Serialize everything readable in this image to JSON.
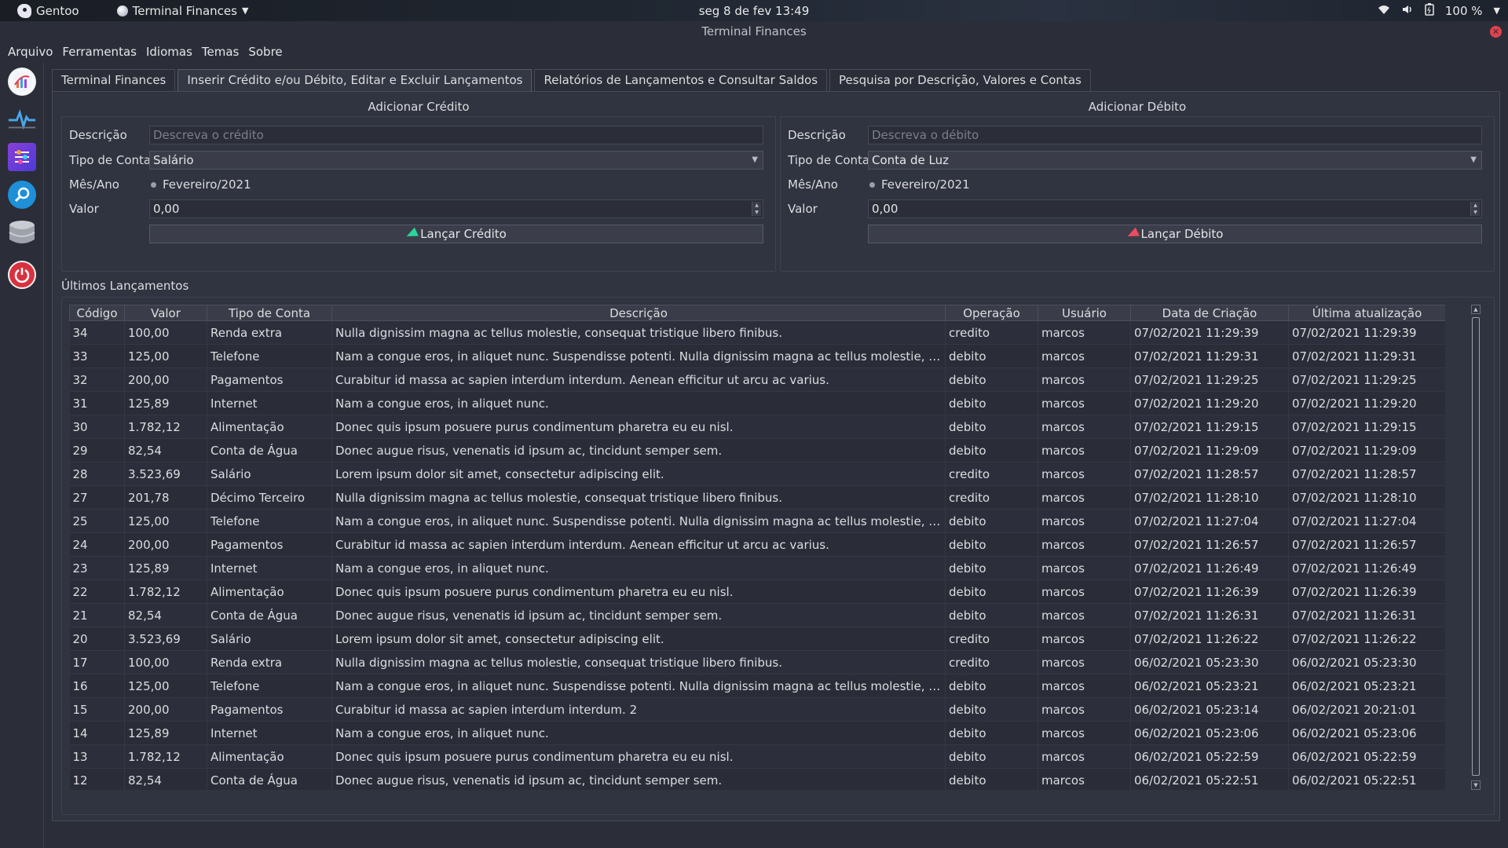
{
  "topbar": {
    "os_name": "Gentoo",
    "app_menu": "Terminal Finances",
    "clock": "seg 8 de fev  13:49",
    "battery": "100 %"
  },
  "window": {
    "title": "Terminal Finances"
  },
  "menu": [
    "Arquivo",
    "Ferramentas",
    "Idiomas",
    "Temas",
    "Sobre"
  ],
  "sidebar_icons": [
    "chart-icon",
    "activity-icon",
    "settings-sliders-icon",
    "search-icon",
    "database-icon",
    "power-icon"
  ],
  "tabs": [
    "Terminal Finances",
    "Inserir Crédito e/ou Débito, Editar e Excluir Lançamentos",
    "Relatórios de Lançamentos e Consultar Saldos",
    "Pesquisa por Descrição, Valores e Contas"
  ],
  "active_tab": 1,
  "credit": {
    "title": "Adicionar Crédito",
    "desc_label": "Descrição",
    "desc_placeholder": "Descreva o crédito",
    "type_label": "Tipo de Conta",
    "type_value": "Salário",
    "month_label": "Mês/Ano",
    "month_value": "Fevereiro/2021",
    "value_label": "Valor",
    "value": "0,00",
    "button": "Lançar Crédito"
  },
  "debit": {
    "title": "Adicionar Débito",
    "desc_label": "Descrição",
    "desc_placeholder": "Descreva o débito",
    "type_label": "Tipo de Conta",
    "type_value": "Conta de Luz",
    "month_label": "Mês/Ano",
    "month_value": "Fevereiro/2021",
    "value_label": "Valor",
    "value": "0,00",
    "button": "Lançar Débito"
  },
  "recent": {
    "title": "Últimos Lançamentos",
    "columns": [
      "Código",
      "Valor",
      "Tipo de Conta",
      "Descrição",
      "Operação",
      "Usuário",
      "Data de Criação",
      "Última atualização"
    ],
    "rows": [
      [
        "34",
        "100,00",
        "Renda extra",
        "Nulla dignissim magna ac tellus molestie, consequat tristique libero finibus.",
        "credito",
        "marcos",
        "07/02/2021 11:29:39",
        "07/02/2021 11:29:39"
      ],
      [
        "33",
        "125,00",
        "Telefone",
        "Nam a congue eros, in aliquet nunc. Suspendisse potenti. Nulla dignissim magna ac tellus molestie, consequat tristique libero finibus.",
        "debito",
        "marcos",
        "07/02/2021 11:29:31",
        "07/02/2021 11:29:31"
      ],
      [
        "32",
        "200,00",
        "Pagamentos",
        "Curabitur id massa ac sapien interdum interdum. Aenean efficitur ut arcu ac varius.",
        "debito",
        "marcos",
        "07/02/2021 11:29:25",
        "07/02/2021 11:29:25"
      ],
      [
        "31",
        "125,89",
        "Internet",
        "Nam a congue eros, in aliquet nunc.",
        "debito",
        "marcos",
        "07/02/2021 11:29:20",
        "07/02/2021 11:29:20"
      ],
      [
        "30",
        "1.782,12",
        "Alimentação",
        "Donec quis ipsum posuere purus condimentum pharetra eu eu nisl.",
        "debito",
        "marcos",
        "07/02/2021 11:29:15",
        "07/02/2021 11:29:15"
      ],
      [
        "29",
        "82,54",
        "Conta de Água",
        "Donec augue risus, venenatis id ipsum ac, tincidunt semper sem.",
        "debito",
        "marcos",
        "07/02/2021 11:29:09",
        "07/02/2021 11:29:09"
      ],
      [
        "28",
        "3.523,69",
        "Salário",
        "Lorem ipsum dolor sit amet, consectetur adipiscing elit.",
        "credito",
        "marcos",
        "07/02/2021 11:28:57",
        "07/02/2021 11:28:57"
      ],
      [
        "27",
        "201,78",
        "Décimo Terceiro",
        "Nulla dignissim magna ac tellus molestie, consequat tristique libero finibus.",
        "credito",
        "marcos",
        "07/02/2021 11:28:10",
        "07/02/2021 11:28:10"
      ],
      [
        "25",
        "125,00",
        "Telefone",
        "Nam a congue eros, in aliquet nunc. Suspendisse potenti. Nulla dignissim magna ac tellus molestie, consequat tristique libero finibus.",
        "debito",
        "marcos",
        "07/02/2021 11:27:04",
        "07/02/2021 11:27:04"
      ],
      [
        "24",
        "200,00",
        "Pagamentos",
        "Curabitur id massa ac sapien interdum interdum. Aenean efficitur ut arcu ac varius.",
        "debito",
        "marcos",
        "07/02/2021 11:26:57",
        "07/02/2021 11:26:57"
      ],
      [
        "23",
        "125,89",
        "Internet",
        "Nam a congue eros, in aliquet nunc.",
        "debito",
        "marcos",
        "07/02/2021 11:26:49",
        "07/02/2021 11:26:49"
      ],
      [
        "22",
        "1.782,12",
        "Alimentação",
        "Donec quis ipsum posuere purus condimentum pharetra eu eu nisl.",
        "debito",
        "marcos",
        "07/02/2021 11:26:39",
        "07/02/2021 11:26:39"
      ],
      [
        "21",
        "82,54",
        "Conta de Água",
        "Donec augue risus, venenatis id ipsum ac, tincidunt semper sem.",
        "debito",
        "marcos",
        "07/02/2021 11:26:31",
        "07/02/2021 11:26:31"
      ],
      [
        "20",
        "3.523,69",
        "Salário",
        "Lorem ipsum dolor sit amet, consectetur adipiscing elit.",
        "credito",
        "marcos",
        "07/02/2021 11:26:22",
        "07/02/2021 11:26:22"
      ],
      [
        "17",
        "100,00",
        "Renda extra",
        "Nulla dignissim magna ac tellus molestie, consequat tristique libero finibus.",
        "credito",
        "marcos",
        "06/02/2021 05:23:30",
        "06/02/2021 05:23:30"
      ],
      [
        "16",
        "125,00",
        "Telefone",
        "Nam a congue eros, in aliquet nunc. Suspendisse potenti. Nulla dignissim magna ac tellus molestie, consequat tristique libero finibus.",
        "debito",
        "marcos",
        "06/02/2021 05:23:21",
        "06/02/2021 05:23:21"
      ],
      [
        "15",
        "200,00",
        "Pagamentos",
        "Curabitur id massa ac sapien interdum interdum.  2",
        "debito",
        "marcos",
        "06/02/2021 05:23:14",
        "06/02/2021 20:21:01"
      ],
      [
        "14",
        "125,89",
        "Internet",
        "Nam a congue eros, in aliquet nunc.",
        "debito",
        "marcos",
        "06/02/2021 05:23:06",
        "06/02/2021 05:23:06"
      ],
      [
        "13",
        "1.782,12",
        "Alimentação",
        "Donec quis ipsum posuere purus condimentum pharetra eu eu nisl.",
        "debito",
        "marcos",
        "06/02/2021 05:22:59",
        "06/02/2021 05:22:59"
      ],
      [
        "12",
        "82,54",
        "Conta de Água",
        "Donec augue risus, venenatis id ipsum ac, tincidunt semper sem.",
        "debito",
        "marcos",
        "06/02/2021 05:22:51",
        "06/02/2021 05:22:51"
      ]
    ]
  }
}
